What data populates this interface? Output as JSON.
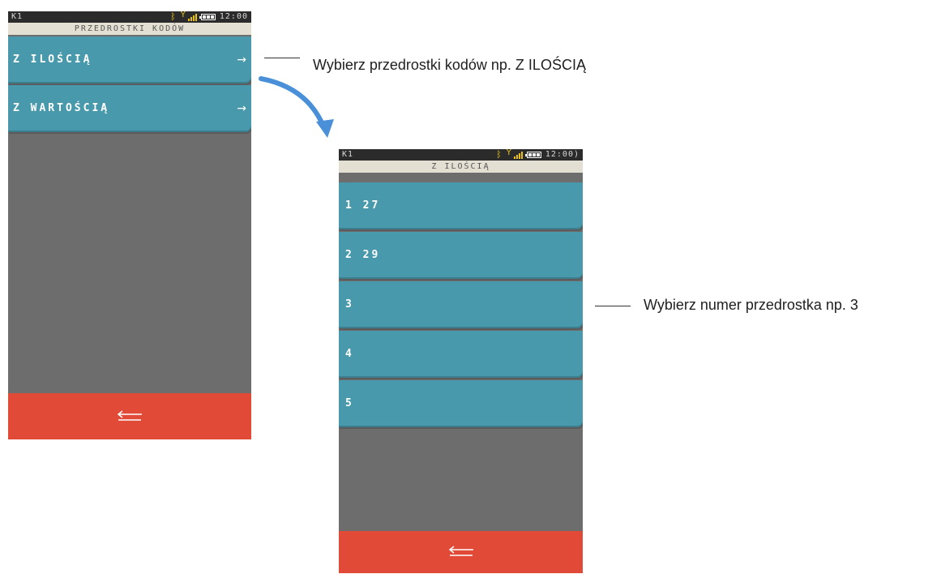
{
  "screen1": {
    "status": {
      "slot": "K1",
      "time": "12:00"
    },
    "title": "PRZEDROSTKI KODÓW",
    "items": [
      {
        "label": "Z ILOŚCIĄ",
        "arrow": "→"
      },
      {
        "label": "Z WARTOŚCIĄ",
        "arrow": "→"
      }
    ]
  },
  "screen2": {
    "status": {
      "slot": "K1",
      "time": "12:00)"
    },
    "title": "Z ILOŚCIĄ",
    "items": [
      {
        "label": "1 27"
      },
      {
        "label": "2 29"
      },
      {
        "label": "3"
      },
      {
        "label": "4"
      },
      {
        "label": "5"
      }
    ]
  },
  "callouts": {
    "first": "Wybierz przedrostki kodów np. Z ILOŚCIĄ",
    "second": "Wybierz numer przedrostka np. 3"
  },
  "colors": {
    "accent_blue": "#4899ab",
    "back_red": "#e24a38",
    "title_beige": "#e4dfd3",
    "connector_arrow": "#4a90d9"
  },
  "icons": [
    "bluetooth-icon",
    "signal-icon",
    "battery-icon",
    "arrow-right-icon",
    "back-arrow-icon"
  ]
}
